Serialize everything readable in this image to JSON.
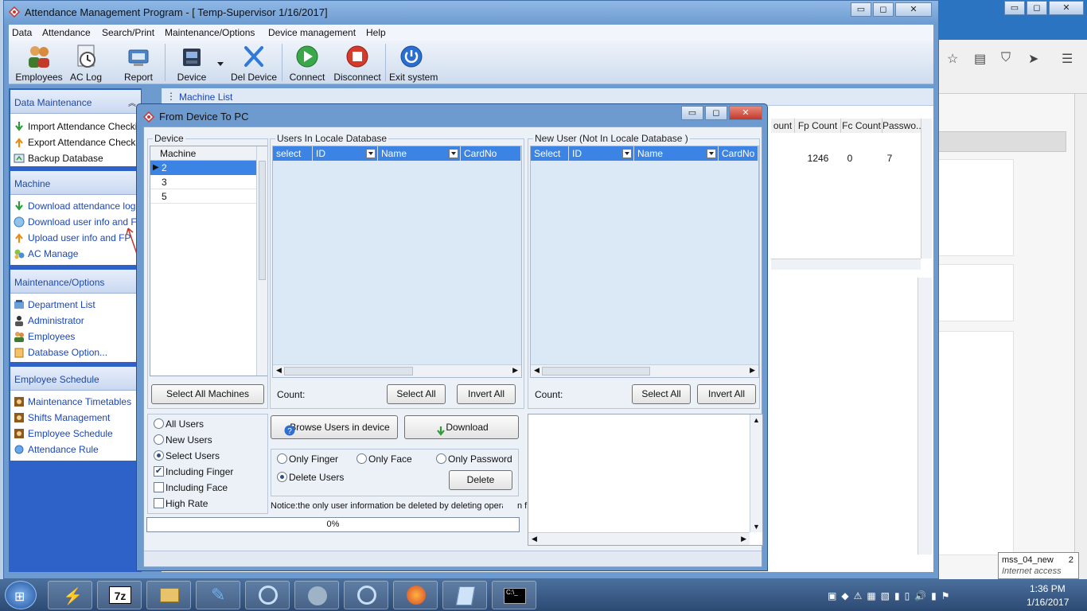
{
  "window": {
    "title": "Attendance Management Program - [ Temp-Supervisor 1/16/2017]",
    "controls": [
      "▭",
      "◻",
      "✕"
    ]
  },
  "menu": [
    "Data",
    "Attendance",
    "Search/Print",
    "Maintenance/Options",
    "Device management",
    "Help"
  ],
  "toolbar": [
    {
      "label": "Employees",
      "icon": "employees-icon"
    },
    {
      "label": "AC Log",
      "icon": "clock-icon"
    },
    {
      "label": "Report",
      "icon": "report-icon"
    },
    {
      "label": "Device",
      "icon": "device-icon"
    },
    {
      "label": "Del Device",
      "icon": "delete-x-icon"
    },
    {
      "label": "Connect",
      "icon": "connect-play-icon"
    },
    {
      "label": "Disconnect",
      "icon": "disconnect-stop-icon"
    },
    {
      "label": "Exit system",
      "icon": "power-icon"
    }
  ],
  "sidebar": {
    "data_maintenance": {
      "title": "Data Maintenance",
      "items": [
        "Import Attendance Checking",
        "Export Attendance Checking",
        "Backup Database"
      ]
    },
    "machine": {
      "title": "Machine",
      "items": [
        "Download attendance logs",
        "Download user info and Fp",
        "Upload user info and FP",
        "AC Manage"
      ]
    },
    "maintenance_options": {
      "title": "Maintenance/Options",
      "items": [
        "Department List",
        "Administrator",
        "Employees",
        "Database Option..."
      ]
    },
    "employee_schedule": {
      "title": "Employee Schedule",
      "items": [
        "Maintenance Timetables",
        "Shifts Management",
        "Employee Schedule",
        "Attendance Rule"
      ]
    }
  },
  "machine_list": {
    "tab": "Machine List",
    "headers": [
      "ount",
      "Fp Count",
      "Fc Count",
      "Passwo..."
    ],
    "row": [
      "",
      "1246",
      "0",
      "7"
    ]
  },
  "dialog": {
    "title": "From Device To PC",
    "device_group": {
      "label": "Device",
      "column": "Machine",
      "machines": [
        "2",
        "3",
        "5"
      ],
      "select_all_button": "Select All Machines"
    },
    "locale_group": {
      "label": "Users In Locale Database",
      "columns": [
        "select",
        "ID",
        "Name",
        "CardNo"
      ],
      "count_label": "Count:",
      "select_all": "Select All",
      "invert_all": "Invert All"
    },
    "new_user_group": {
      "label": "New User (Not In Locale Database )",
      "columns": [
        "Select",
        "ID",
        "Name",
        "CardNo"
      ],
      "count_label": "Count:",
      "select_all": "Select All",
      "invert_all": "Invert All"
    },
    "filters": {
      "all_users": "All Users",
      "new_users": "New Users",
      "select_users": "Select Users",
      "including_finger": "Including Finger",
      "including_face": "Including Face",
      "high_rate": "High Rate",
      "selected": "Select Users",
      "including_finger_checked": true,
      "including_face_checked": false,
      "high_rate_checked": false
    },
    "browse_button": "Browse Users in device",
    "download_button": "Download",
    "delete_options": {
      "only_finger": "Only Finger",
      "only_face": "Only Face",
      "only_password": "Only Password",
      "delete_users": "Delete Users",
      "selected": "Delete Users",
      "delete_button": "Delete"
    },
    "notice": "Notice:the only user information  be deleted by deleting operat",
    "notice_tail": "n f",
    "progress_text": "0%",
    "progress_value": 0
  },
  "firefox": {
    "tooltip_title": "mss_04_new",
    "tooltip_badge": "2",
    "tooltip_sub": "Internet access"
  },
  "taskbar": {
    "time": "1:36 PM",
    "date": "1/16/2017"
  }
}
